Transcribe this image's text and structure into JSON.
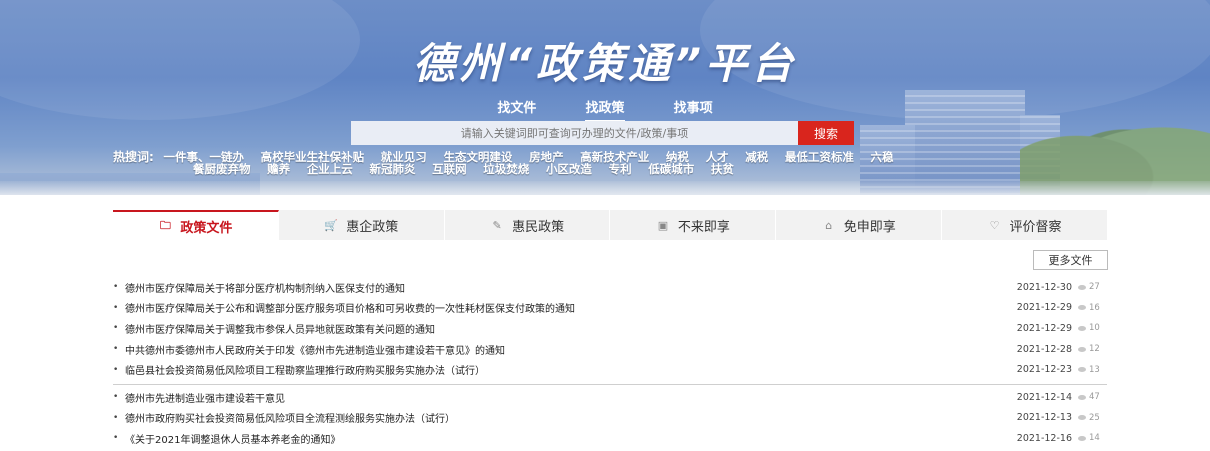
{
  "header": {
    "title": "德州“政策通”平台",
    "search_tabs": [
      {
        "label": "找文件"
      },
      {
        "label": "找政策",
        "active": true
      },
      {
        "label": "找事项"
      }
    ],
    "search": {
      "placeholder": "请输入关键词即可查询可办理的文件/政策/事项",
      "button_label": "搜索"
    },
    "hot": {
      "label": "热搜词:",
      "row1": [
        "一件事、一链办",
        "高校毕业生社保补贴",
        "就业见习",
        "生态文明建设",
        "房地产",
        "高新技术产业",
        "纳税",
        "人才",
        "减税",
        "最低工资标准",
        "六稳"
      ],
      "row2": [
        "餐厨废弃物",
        "赡养",
        "企业上云",
        "新冠肺炎",
        "互联网",
        "垃圾焚烧",
        "小区改造",
        "专利",
        "低碳城市",
        "扶贫"
      ]
    }
  },
  "category_tabs": [
    {
      "label": "政策文件",
      "icon": "folder-icon",
      "glyph": "🗀",
      "active": true
    },
    {
      "label": "惠企政策",
      "icon": "cart-icon",
      "glyph": "🛒"
    },
    {
      "label": "惠民政策",
      "icon": "edit-icon",
      "glyph": "✎"
    },
    {
      "label": "不来即享",
      "icon": "screen-icon",
      "glyph": "▣"
    },
    {
      "label": "免申即享",
      "icon": "bank-icon",
      "glyph": "⌂"
    },
    {
      "label": "评价督察",
      "icon": "heart-icon",
      "glyph": "♡"
    }
  ],
  "more_button_label": "更多文件",
  "documents_group1": [
    {
      "title": "德州市医疗保障局关于将部分医疗机构制剂纳入医保支付的通知",
      "date": "2021-12-30",
      "views": "27"
    },
    {
      "title": "德州市医疗保障局关于公布和调整部分医疗服务项目价格和可另收费的一次性耗材医保支付政策的通知",
      "date": "2021-12-29",
      "views": "16"
    },
    {
      "title": "德州市医疗保障局关于调整我市参保人员异地就医政策有关问题的通知",
      "date": "2021-12-29",
      "views": "10"
    },
    {
      "title": "中共德州市委德州市人民政府关于印发《德州市先进制造业强市建设若干意见》的通知",
      "date": "2021-12-28",
      "views": "12"
    },
    {
      "title": "临邑县社会投资简易低风险项目工程勘察监理推行政府购买服务实施办法（试行）",
      "date": "2021-12-23",
      "views": "13"
    }
  ],
  "documents_group2": [
    {
      "title": "德州市先进制造业强市建设若干意见",
      "date": "2021-12-14",
      "views": "47"
    },
    {
      "title": "德州市政府购买社会投资简易低风险项目全流程测绘服务实施办法（试行）",
      "date": "2021-12-13",
      "views": "25"
    },
    {
      "title": "《关于2021年调整退休人员基本养老金的通知》",
      "date": "2021-12-16",
      "views": "14"
    }
  ],
  "colors": {
    "accent_red": "#c8161e",
    "search_red": "#d9251d",
    "banner_blue": "#6d8ec7"
  }
}
